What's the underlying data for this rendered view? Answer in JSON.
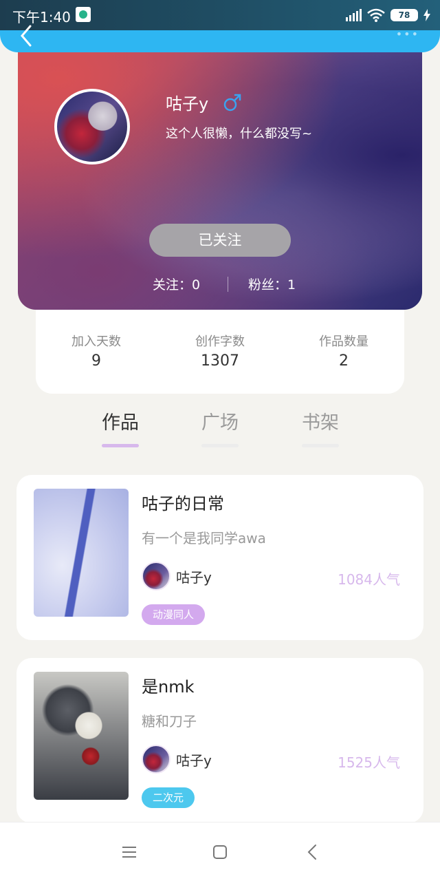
{
  "status_bar": {
    "time": "下午1:40",
    "battery": "78"
  },
  "profile": {
    "name": "咕子y",
    "bio": "这个人很懒，什么都没写~",
    "follow_button": "已关注",
    "follows_label": "关注：0",
    "fans_label": "粉丝：1"
  },
  "info": [
    {
      "label": "加入天数",
      "value": "9"
    },
    {
      "label": "创作字数",
      "value": "1307"
    },
    {
      "label": "作品数量",
      "value": "2"
    }
  ],
  "tabs": [
    {
      "label": "作品",
      "active": true
    },
    {
      "label": "广场",
      "active": false
    },
    {
      "label": "书架",
      "active": false
    }
  ],
  "works": [
    {
      "title": "咕子的日常",
      "desc": "有一个是我同学awa",
      "author": "咕子y",
      "popularity": "1084人气",
      "tag": "动漫同人",
      "tag_color": "#d3a9ee"
    },
    {
      "title": "是nmk",
      "desc": "糖和刀子",
      "author": "咕子y",
      "popularity": "1525人气",
      "tag": "二次元",
      "tag_color": "#4dc8ee"
    }
  ],
  "colors": {
    "accent_top": "#2eb6f2",
    "tab_underline": "#d7b8ec",
    "popularity": "#d7b8ec"
  }
}
